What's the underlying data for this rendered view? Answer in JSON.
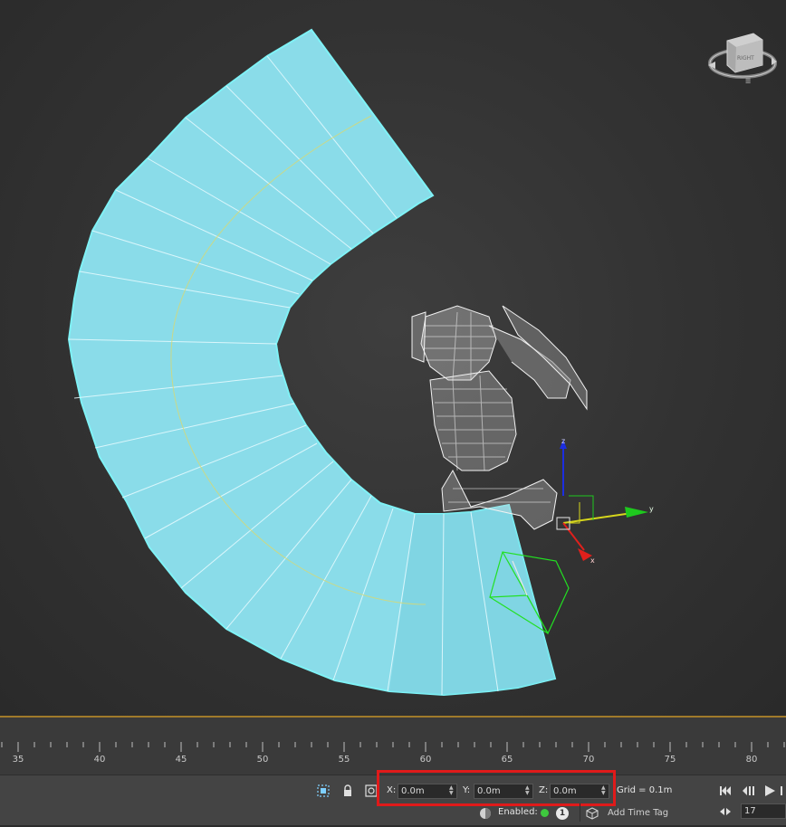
{
  "viewport": {
    "viewcube_label": "RIGHT",
    "gizmo_axes": {
      "x": "x",
      "y": "y",
      "z": "z"
    },
    "colors": {
      "surface": "#8adce9",
      "surface_edge": "#7ff2f6",
      "grid_line": "#2f2f2f",
      "gizmo_x": "#e0201c",
      "gizmo_y": "#1ec81e",
      "gizmo_z": "#1c2ee0",
      "camera_box": "#22e022"
    }
  },
  "timeline": {
    "ticks": [
      "35",
      "40",
      "45",
      "50",
      "55",
      "60",
      "65",
      "70",
      "75",
      "80"
    ],
    "separator_color": "#a07a2a"
  },
  "status": {
    "coords": {
      "x_label": "X:",
      "x_value": "0.0m",
      "y_label": "Y:",
      "y_value": "0.0m",
      "z_label": "Z:",
      "z_value": "0.0m"
    },
    "grid": "Grid = 0.1m",
    "enabled_label": "Enabled:",
    "enabled_badge": "1",
    "add_time_tag": "Add Time Tag",
    "current_frame": "17",
    "highlight_color": "#e01a1a"
  },
  "icons": [
    "selection-lock-toggle-icon",
    "lock-icon",
    "absolute-mode-icon",
    "adaptive-degradation-icon",
    "time-tag-icon",
    "go-to-start-icon",
    "previous-frame-icon",
    "play-icon",
    "next-key-icon"
  ]
}
